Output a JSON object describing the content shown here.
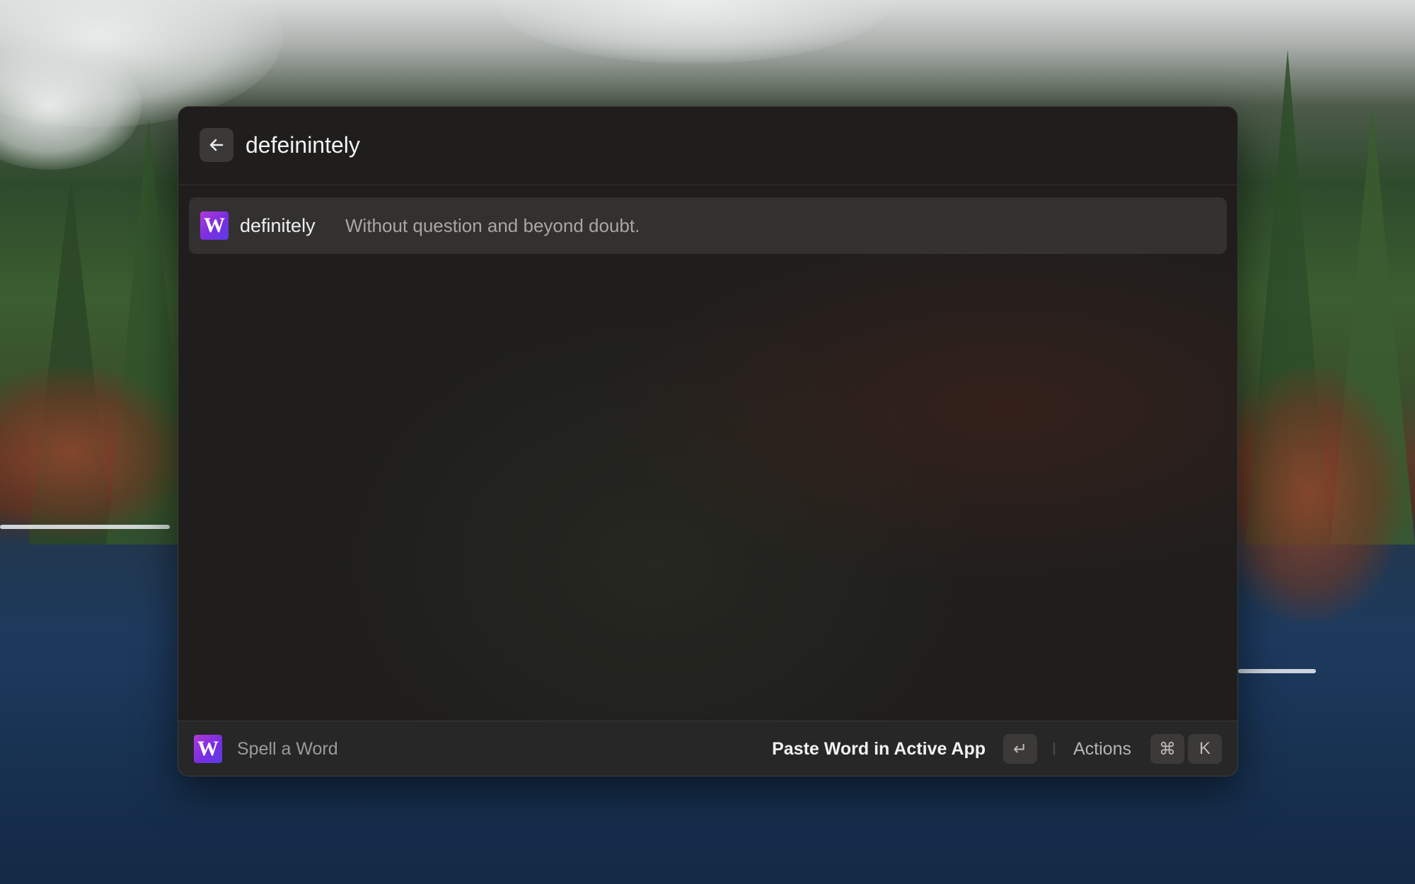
{
  "search": {
    "query": "defeinintely"
  },
  "results": [
    {
      "icon_letter": "W",
      "title": "definitely",
      "subtitle": "Without question and beyond doubt."
    }
  ],
  "footer": {
    "icon_letter": "W",
    "command_title": "Spell a Word",
    "primary_action_label": "Paste Word in Active App",
    "primary_action_key": "↵",
    "actions_label": "Actions",
    "actions_keys": [
      "⌘",
      "K"
    ]
  },
  "colors": {
    "icon_gradient_start": "#b03ad8",
    "icon_gradient_end": "#5b3de8",
    "window_background": "#1f1e1d"
  },
  "icons": {
    "back": "arrow-left-icon",
    "extension": "w-dictionary-icon"
  }
}
